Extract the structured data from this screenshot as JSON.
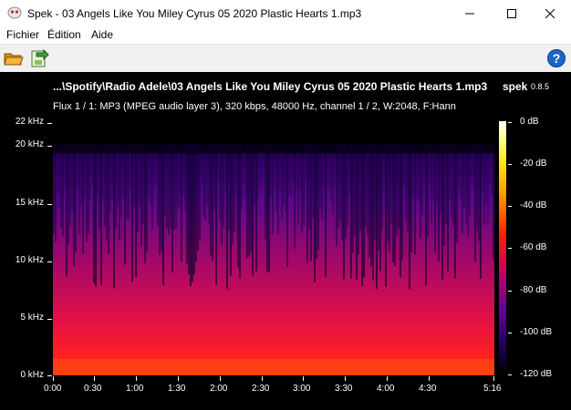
{
  "window": {
    "title": "Spek - 03 Angels Like You Miley Cyrus 05 2020 Plastic Hearts 1.mp3",
    "minimize_icon": "minimize-icon",
    "maximize_icon": "maximize-icon",
    "close_icon": "close-icon"
  },
  "menu": {
    "items": [
      {
        "label": "Fichier"
      },
      {
        "label": "Édition"
      },
      {
        "label": "Aide"
      }
    ]
  },
  "toolbar": {
    "open_icon": "folder-open-icon",
    "save_icon": "save-export-icon",
    "help_label": "?"
  },
  "spek": {
    "file_title": "...\\Spotify\\Radio Adele\\03 Angels Like You Miley Cyrus 05 2020 Plastic Hearts 1.mp3",
    "brand": "spek",
    "version": "0.8.5",
    "stream_info": "Flux 1 / 1: MP3 (MPEG audio layer 3), 320 kbps, 48000 Hz, channel 1 / 2, W:2048, F:Hann",
    "freq_labels": [
      "22 kHz",
      "20 kHz",
      "15 kHz",
      "10 kHz",
      "5 kHz",
      "0 kHz"
    ],
    "time_labels": [
      "0:00",
      "0:30",
      "1:00",
      "1:30",
      "2:00",
      "2:30",
      "3:00",
      "3:30",
      "4:00",
      "4:30",
      "5:16"
    ],
    "db_labels": [
      "0 dB",
      "-20 dB",
      "-40 dB",
      "-60 dB",
      "-80 dB",
      "-100 dB",
      "-120 dB"
    ],
    "colors": {
      "background": "#000000",
      "hot": "#ff2000",
      "mid": "#c00060",
      "cool": "#3a0080"
    }
  }
}
